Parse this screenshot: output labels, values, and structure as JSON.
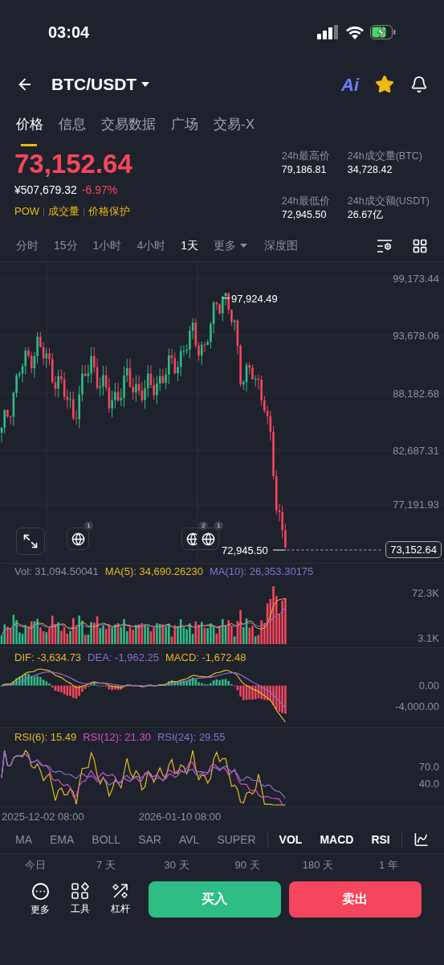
{
  "status_bar": {
    "time": "03:04"
  },
  "header": {
    "pair": "BTC/USDT",
    "ai_label": "Ai",
    "favorite": true
  },
  "tabs": [
    {
      "label": "价格",
      "selected": true
    },
    {
      "label": "信息",
      "selected": false
    },
    {
      "label": "交易数据",
      "selected": false
    },
    {
      "label": "广场",
      "selected": false
    },
    {
      "label": "交易-X",
      "selected": false
    }
  ],
  "price": {
    "last": "73,152.64",
    "cny": "¥507,679.32",
    "change": "-6.97%",
    "tags": [
      "POW",
      "成交量",
      "价格保护"
    ]
  },
  "stats": [
    {
      "label": "24h最高价",
      "value": "79,186.81"
    },
    {
      "label": "24h成交量(BTC)",
      "value": "34,728.42"
    },
    {
      "label": "24h最低价",
      "value": "72,945.50"
    },
    {
      "label": "24h成交额(USDT)",
      "value": "26.67亿"
    }
  ],
  "intervals": [
    {
      "label": "分时",
      "kind": "option",
      "selected": false
    },
    {
      "label": "15分",
      "kind": "option",
      "selected": false
    },
    {
      "label": "1小时",
      "kind": "option",
      "selected": false
    },
    {
      "label": "4小时",
      "kind": "option",
      "selected": false
    },
    {
      "label": "1天",
      "kind": "option",
      "selected": true
    },
    {
      "label": "更多",
      "kind": "dropdown",
      "selected": false
    },
    {
      "label": "深度图",
      "kind": "option",
      "selected": false
    }
  ],
  "main_chart": {
    "y_labels": [
      "99,173.44",
      "93,678.06",
      "88,182.68",
      "82,687.31",
      "77,191.93"
    ],
    "high_marker": "97,924.49",
    "low_marker": "72,945.50",
    "last_price_tag": "73,152.64",
    "events": [
      {
        "badge": "1"
      },
      {
        "badge": "2"
      },
      {
        "badge": "1"
      }
    ]
  },
  "volume": {
    "legend": [
      {
        "text": "Vol: 31,094.50041",
        "color": "#8b909a"
      },
      {
        "text": "MA(5): 34,690.26230",
        "color": "#e8b923"
      },
      {
        "text": "MA(10): 26,353.30175",
        "color": "#8c6fd1"
      }
    ],
    "y_labels": [
      "72.3K",
      "3.1K"
    ]
  },
  "macd": {
    "legend": [
      {
        "text": "DIF: -3,634.73",
        "color": "#e8b923"
      },
      {
        "text": "DEA: -1,962.25",
        "color": "#8c6fd1"
      },
      {
        "text": "MACD: -1,672.48",
        "color": "#e8b923"
      }
    ],
    "y_labels": [
      "0.00",
      "-4,000.00"
    ]
  },
  "rsi": {
    "legend": [
      {
        "text": "RSI(6): 15.49",
        "color": "#e8b923"
      },
      {
        "text": "RSI(12): 21.30",
        "color": "#d84fc9"
      },
      {
        "text": "RSI(24): 29.55",
        "color": "#8c6fd1"
      }
    ],
    "y_labels": [
      "70.0",
      "40.0"
    ]
  },
  "x_labels": [
    "2025-12-02 08:00",
    "2026-01-10 08:00"
  ],
  "indicators": [
    {
      "label": "MA",
      "selected": false
    },
    {
      "label": "EMA",
      "selected": false
    },
    {
      "label": "BOLL",
      "selected": false
    },
    {
      "label": "SAR",
      "selected": false
    },
    {
      "label": "AVL",
      "selected": false
    },
    {
      "label": "SUPER",
      "selected": false
    },
    {
      "label": "VOL",
      "selected": true
    },
    {
      "label": "MACD",
      "selected": true
    },
    {
      "label": "RSI",
      "selected": true
    }
  ],
  "ranges": [
    "今日",
    "7 天",
    "30 天",
    "90 天",
    "180 天",
    "1 年"
  ],
  "bottom": {
    "tools": [
      {
        "label": "更多",
        "kind": "more"
      },
      {
        "label": "工具",
        "kind": "tools"
      },
      {
        "label": "杠杆",
        "kind": "leverage"
      }
    ],
    "buy": "买入",
    "sell": "卖出"
  }
}
